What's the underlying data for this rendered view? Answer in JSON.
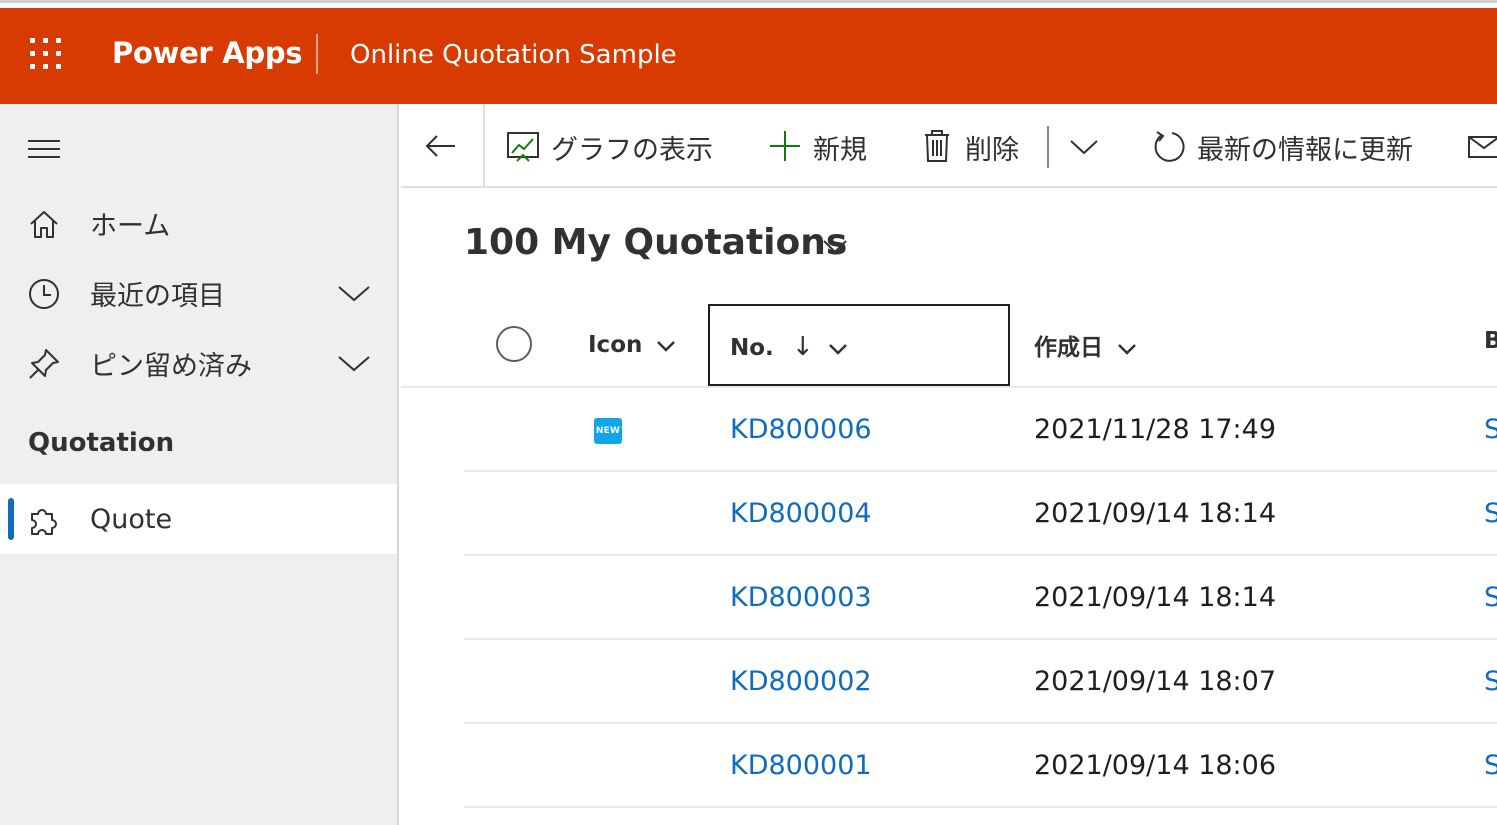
{
  "header": {
    "app_name": "Power Apps",
    "sub_title": "Online Quotation Sample",
    "brand_color": "#d83b01"
  },
  "sidebar": {
    "items": [
      {
        "label": "ホーム",
        "icon": "home-icon"
      },
      {
        "label": "最近の項目",
        "icon": "clock-icon",
        "expandable": true
      },
      {
        "label": "ピン留め済み",
        "icon": "pin-icon",
        "expandable": true
      }
    ],
    "section_title": "Quotation",
    "selected_item": {
      "label": "Quote",
      "icon": "puzzle-icon"
    }
  },
  "commandbar": {
    "show_chart": "グラフの表示",
    "new": "新規",
    "delete": "削除",
    "refresh": "最新の情報に更新"
  },
  "view": {
    "title": "100 My Quotations"
  },
  "grid": {
    "columns": {
      "icon": "Icon",
      "no": "No.",
      "sort_arrow": "↓",
      "created": "作成日",
      "cut": "B"
    },
    "rows": [
      {
        "badge": "NEW",
        "no": "KD800006",
        "created": "2021/11/28 17:49",
        "cut": "S"
      },
      {
        "badge": "",
        "no": "KD800004",
        "created": "2021/09/14 18:14",
        "cut": "S"
      },
      {
        "badge": "",
        "no": "KD800003",
        "created": "2021/09/14 18:14",
        "cut": "S"
      },
      {
        "badge": "",
        "no": "KD800002",
        "created": "2021/09/14 18:07",
        "cut": "S"
      },
      {
        "badge": "",
        "no": "KD800001",
        "created": "2021/09/14 18:06",
        "cut": "S"
      }
    ],
    "link_color": "#0f6cbd",
    "badge_color": "#0ea5e9"
  }
}
